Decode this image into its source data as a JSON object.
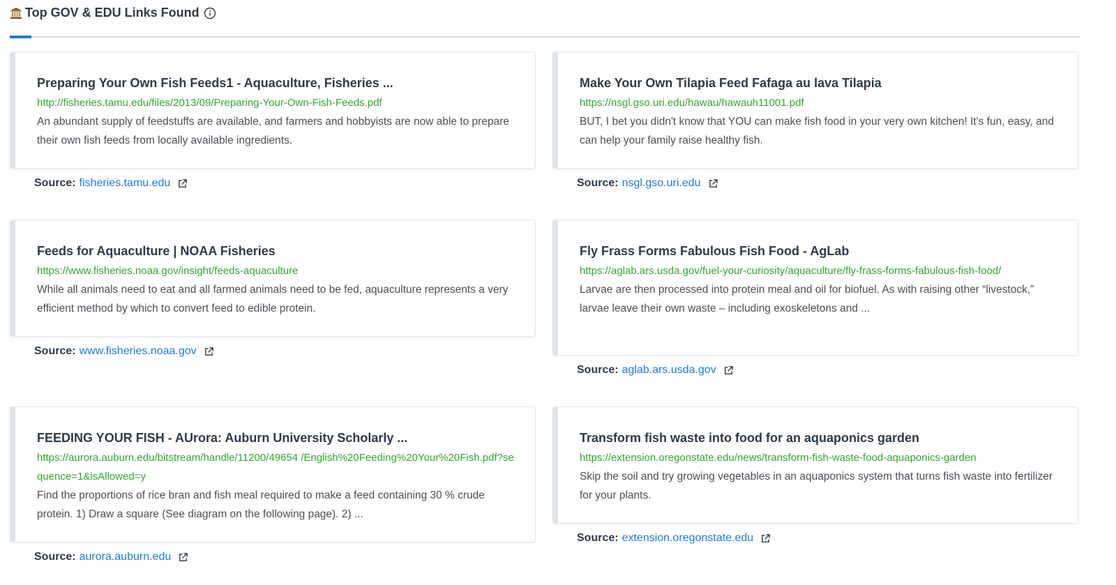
{
  "header": {
    "title": "Top GOV & EDU Links Found"
  },
  "source_prefix": "Source:",
  "left": [
    {
      "title": "Preparing Your Own Fish Feeds1 - Aquaculture, Fisheries ...",
      "url": "http://fisheries.tamu.edu/files/2013/09/Preparing-Your-Own-Fish-Feeds.pdf",
      "snippet": "An abundant supply of feedstuffs are available, and farmers and hobbyists are now able to prepare their own fish feeds from locally available ingredients.",
      "source": "fisheries.tamu.edu"
    },
    {
      "title": "Feeds for Aquaculture | NOAA Fisheries",
      "url": "https://www.fisheries.noaa.gov/insight/feeds-aquaculture",
      "snippet": "While all animals need to eat and all farmed animals need to be fed, aquaculture represents a very efficient method by which to convert feed to edible protein.",
      "source": "www.fisheries.noaa.gov"
    },
    {
      "title": "FEEDING YOUR FISH - AUrora: Auburn University Scholarly ...",
      "url": "https://aurora.auburn.edu/bitstream/handle/11200/49654 /English%20Feeding%20Your%20Fish.pdf?sequence=1&isAllowed=y",
      "snippet": "Find the proportions of rice bran and fish meal required to make a feed containing 30 % crude protein. 1) Draw a square (See diagram on the following page). 2) ...",
      "source": "aurora.auburn.edu"
    }
  ],
  "right": [
    {
      "title": "Make Your Own Tilapia Feed Fafaga au lava Tilapia",
      "url": "https://nsgl.gso.uri.edu/hawau/hawauh11001.pdf",
      "snippet": "BUT, I bet you didn't know that YOU can make fish food in your very own kitchen! It's fun, easy, and can help your family raise healthy fish.",
      "source": "nsgl.gso.uri.edu"
    },
    {
      "title": "Fly Frass Forms Fabulous Fish Food - AgLab",
      "url": "https://aglab.ars.usda.gov/fuel-your-curiosity/aquaculture/fly-frass-forms-fabulous-fish-food/",
      "snippet": "Larvae are then processed into protein meal and oil for biofuel. As with raising other “livestock,” larvae leave their own waste – including exoskeletons and ...",
      "source": "aglab.ars.usda.gov"
    },
    {
      "title": "Transform fish waste into food for an aquaponics garden",
      "url": "https://extension.oregonstate.edu/news/transform-fish-waste-food-aquaponics-garden",
      "snippet": "Skip the soil and try growing vegetables in an aquaponics system that turns fish waste into fertilizer for your plants.",
      "source": "extension.oregonstate.edu"
    }
  ]
}
